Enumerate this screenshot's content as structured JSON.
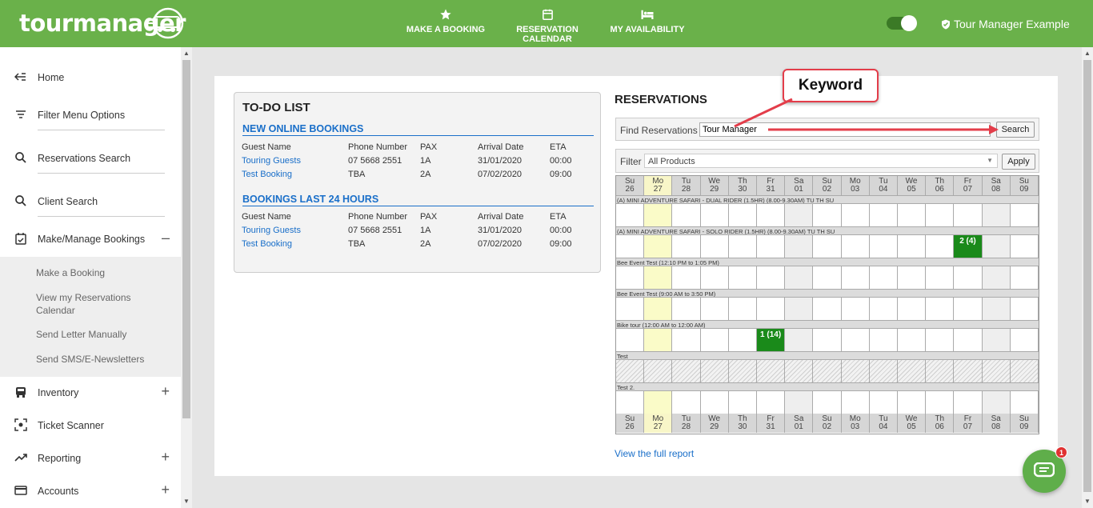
{
  "header": {
    "logo": "tourmanager",
    "nav": [
      {
        "label": "MAKE A BOOKING",
        "icon": "star-icon"
      },
      {
        "label": "RESERVATION CALENDAR",
        "icon": "calendar-icon"
      },
      {
        "label": "MY AVAILABILITY",
        "icon": "bed-icon"
      }
    ],
    "user_name": "Tour Manager Example"
  },
  "sidebar": {
    "items": [
      {
        "label": "Home",
        "icon": "arrow-left-icon"
      },
      {
        "label": "Filter Menu Options",
        "icon": "filter-icon"
      },
      {
        "label": "Reservations Search",
        "icon": "search-icon"
      },
      {
        "label": "Client Search",
        "icon": "search-icon"
      },
      {
        "label": "Make/Manage Bookings",
        "icon": "calendar-check-icon",
        "toggle": "–"
      },
      {
        "label": "Inventory",
        "icon": "bus-icon",
        "toggle": "+"
      },
      {
        "label": "Ticket Scanner",
        "icon": "scanner-icon"
      },
      {
        "label": "Reporting",
        "icon": "trend-icon",
        "toggle": "+"
      },
      {
        "label": "Accounts",
        "icon": "card-icon",
        "toggle": "+"
      }
    ],
    "sub_items": [
      "Make a Booking",
      "View my Reservations Calendar",
      "Send Letter Manually",
      "Send SMS/E-Newsletters"
    ]
  },
  "todo": {
    "title": "TO-DO LIST",
    "columns": [
      "Guest Name",
      "Phone Number",
      "PAX",
      "Arrival Date",
      "ETA"
    ],
    "sections": [
      {
        "title": "NEW ONLINE BOOKINGS",
        "rows": [
          [
            "Touring Guests",
            "07 5668 2551",
            "1A",
            "31/01/2020",
            "00:00"
          ],
          [
            "Test Booking",
            "TBA",
            "2A",
            "07/02/2020",
            "09:00"
          ]
        ]
      },
      {
        "title": "BOOKINGS LAST 24 HOURS",
        "rows": [
          [
            "Touring Guests",
            "07 5668 2551",
            "1A",
            "31/01/2020",
            "00:00"
          ],
          [
            "Test Booking",
            "TBA",
            "2A",
            "07/02/2020",
            "09:00"
          ]
        ]
      }
    ]
  },
  "reservations": {
    "title": "RESERVATIONS",
    "find_label": "Find Reservations",
    "find_value": "Tour Manager",
    "search_button": "Search",
    "filter_label": "Filter",
    "filter_value": "All Products",
    "apply_button": "Apply",
    "days": [
      [
        "Su",
        "26"
      ],
      [
        "Mo",
        "27"
      ],
      [
        "Tu",
        "28"
      ],
      [
        "We",
        "29"
      ],
      [
        "Th",
        "30"
      ],
      [
        "Fr",
        "31"
      ],
      [
        "Sa",
        "01"
      ],
      [
        "Su",
        "02"
      ],
      [
        "Mo",
        "03"
      ],
      [
        "Tu",
        "04"
      ],
      [
        "We",
        "05"
      ],
      [
        "Th",
        "06"
      ],
      [
        "Fr",
        "07"
      ],
      [
        "Sa",
        "08"
      ],
      [
        "Su",
        "09"
      ]
    ],
    "products": [
      {
        "name": "(A) MINI ADVENTURE SAFARI - DUAL RIDER (1.5HR) (8.00-9.30AM) TU TH SU",
        "style": "normal",
        "bookings": []
      },
      {
        "name": "(A) MINI ADVENTURE SAFARI - SOLO RIDER (1.5HR) (8.00-9.30AM) TU TH SU",
        "style": "normal",
        "bookings": [
          {
            "day": 12,
            "text": "2 (4)"
          }
        ]
      },
      {
        "name": "Bee Event Test (12:10 PM to 1:05 PM)",
        "style": "normal",
        "bookings": []
      },
      {
        "name": "Bee Event Test (9:00 AM to 3:50 PM)",
        "style": "normal",
        "bookings": []
      },
      {
        "name": "Bike tour (12:00 AM to 12:00 AM)",
        "style": "normal",
        "bookings": [
          {
            "day": 5,
            "text": "1 (14)"
          }
        ]
      },
      {
        "name": "Test",
        "style": "hatch",
        "bookings": []
      },
      {
        "name": "Test 2.",
        "style": "normal",
        "bookings": []
      }
    ],
    "full_report": "View the full report"
  },
  "callout": {
    "text": "Keyword"
  },
  "chat": {
    "badge": "1"
  }
}
